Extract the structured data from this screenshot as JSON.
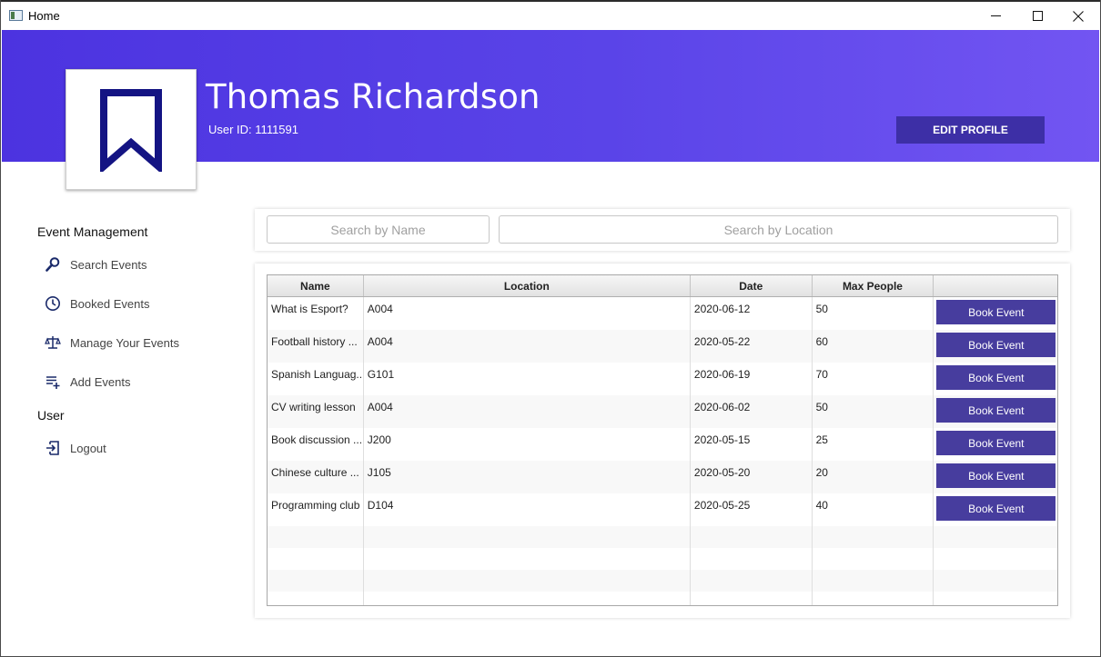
{
  "window": {
    "title": "Home"
  },
  "profile": {
    "name": "Thomas Richardson",
    "user_id": "User ID: 1111591",
    "edit_label": "EDIT PROFILE"
  },
  "colors": {
    "header_start": "#4c33e0",
    "header_end": "#7255f2",
    "accent": "#473d9e",
    "bookmark": "#141483"
  },
  "sidebar": {
    "section_events": "Event Management",
    "items": [
      {
        "label": "Search Events",
        "icon": "search-icon"
      },
      {
        "label": "Booked Events",
        "icon": "clock-icon"
      },
      {
        "label": "Manage Your Events",
        "icon": "scale-icon"
      },
      {
        "label": "Add Events",
        "icon": "playlist-add-icon"
      }
    ],
    "section_user": "User",
    "logout": {
      "label": "Logout",
      "icon": "logout-icon"
    }
  },
  "search": {
    "name_placeholder": "Search by Name",
    "location_placeholder": "Search by Location"
  },
  "table": {
    "columns": [
      "Name",
      "Location",
      "Date",
      "Max People",
      ""
    ],
    "book_label": "Book Event",
    "rows": [
      {
        "name": "What is Esport?",
        "location": "A004",
        "date": "2020-06-12",
        "max": "50"
      },
      {
        "name": "Football history ...",
        "location": "A004",
        "date": "2020-05-22",
        "max": "60"
      },
      {
        "name": "Spanish Languag...",
        "location": "G101",
        "date": "2020-06-19",
        "max": "70"
      },
      {
        "name": "CV writing lesson",
        "location": "A004",
        "date": "2020-06-02",
        "max": "50"
      },
      {
        "name": "Book discussion ...",
        "location": "J200",
        "date": "2020-05-15",
        "max": "25"
      },
      {
        "name": "Chinese culture ...",
        "location": "J105",
        "date": "2020-05-20",
        "max": "20"
      },
      {
        "name": "Programming club",
        "location": "D104",
        "date": "2020-05-25",
        "max": "40"
      }
    ]
  }
}
